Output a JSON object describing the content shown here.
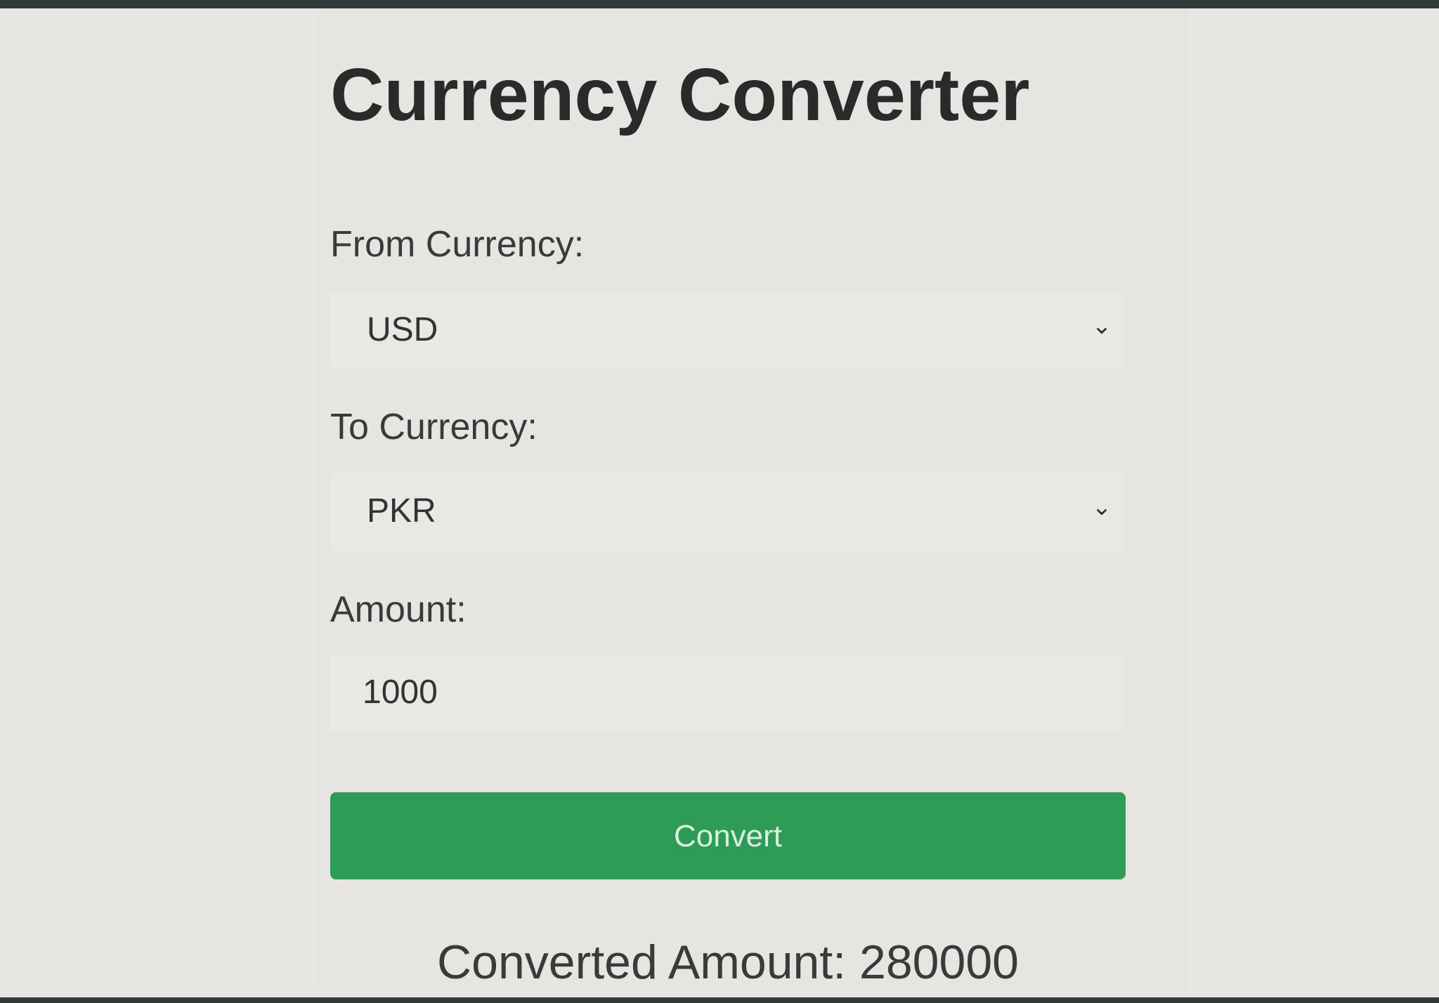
{
  "app": {
    "title": "Currency Converter"
  },
  "form": {
    "from_label": "From Currency:",
    "from_value": "USD",
    "to_label": "To Currency:",
    "to_value": "PKR",
    "amount_label": "Amount:",
    "amount_value": "1000",
    "convert_label": "Convert"
  },
  "result": {
    "text": "Converted Amount: 280000"
  },
  "icons": {
    "dropdown": "chevron-down-icon"
  },
  "colors": {
    "primary_button": "#2e9b57",
    "background": "#e9e7e3"
  }
}
